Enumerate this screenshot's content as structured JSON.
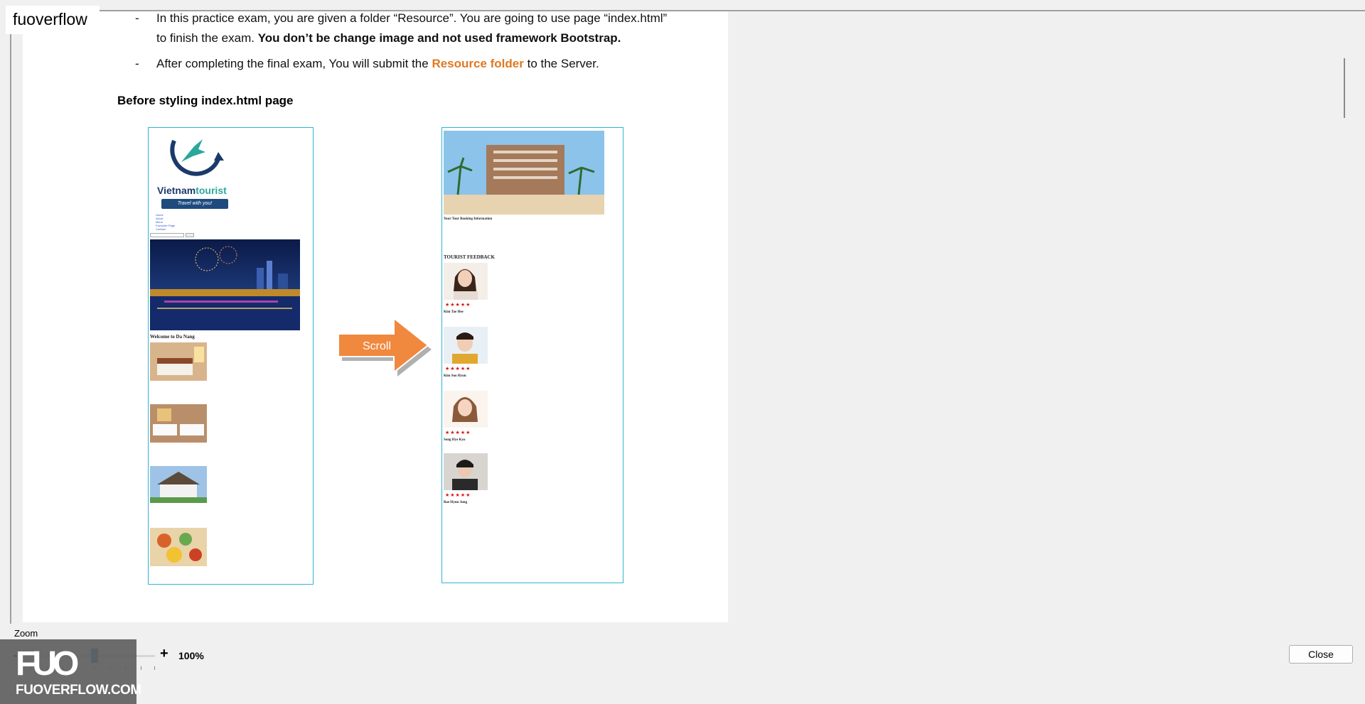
{
  "watermark": {
    "top_left_text": "fuoverflow",
    "bottom_logo_text": "FUOVERFLOW.COM"
  },
  "document": {
    "bullets": [
      {
        "dash": "-",
        "line1": "In this practice exam, you are given a folder “Resource”. You are going to use page “index.html”",
        "line2_plain": "to finish the exam. ",
        "line2_bold": "You don’t be change image and not used framework Bootstrap."
      },
      {
        "dash": "-",
        "prefix": "After completing the final exam, You will submit the ",
        "highlight": "Resource folder",
        "suffix": " to the Server."
      }
    ],
    "section_heading": "Before styling index.html page",
    "mock_left": {
      "logo_text_a": "Vietnam",
      "logo_text_b": "tourist",
      "logo_tagline": "Travel with you!",
      "nav_items": [
        "Home",
        "About",
        "Menu",
        "Favourite Page",
        "Contact"
      ],
      "welcome_heading": "Welcome to Da Nang"
    },
    "scroll_label": "Scroll",
    "mock_right": {
      "booking_heading": "Your Tour Booking Information",
      "feedback_heading": "TOURIST FEEDBACK",
      "stars": "★★★★★",
      "reviewers": [
        "Kim Tae Hee",
        "Kim Soo Hyun",
        "Song Hye Kyo",
        "Bae Hyun Jung"
      ]
    }
  },
  "zoom": {
    "label": "Zoom",
    "minus": "-",
    "plus": "+",
    "value": "100%",
    "level_percent": 100
  },
  "footer": {
    "close_label": "Close"
  }
}
